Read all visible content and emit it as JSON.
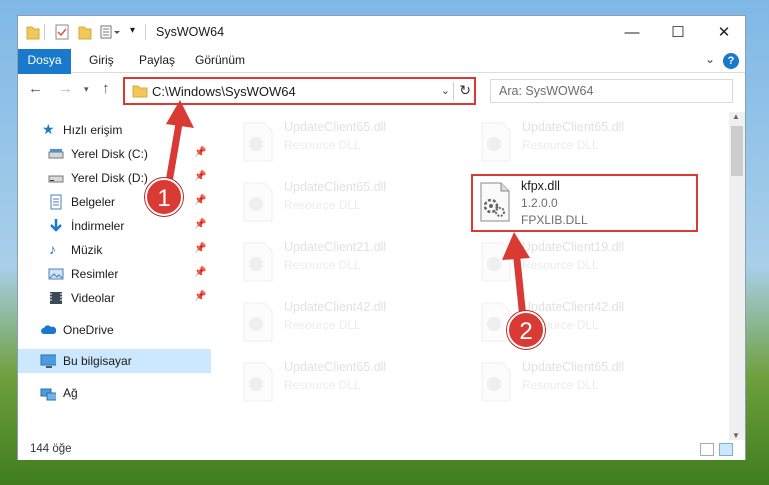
{
  "window": {
    "title": "SysWOW64",
    "controls": {
      "minimize": "—",
      "maximize": "☐",
      "close": "✕"
    }
  },
  "ribbon": {
    "tabs": [
      "Dosya",
      "Giriş",
      "Paylaş",
      "Görünüm"
    ]
  },
  "navigation": {
    "address": "C:\\Windows\\SysWOW64",
    "search_placeholder": "Ara: SysWOW64"
  },
  "sidebar": {
    "items": [
      {
        "label": "Hızlı erişim",
        "icon": "star-icon"
      },
      {
        "label": "Yerel Disk (C:)",
        "icon": "drive-icon",
        "pinned": true
      },
      {
        "label": "Yerel Disk (D:)",
        "icon": "drive-icon",
        "pinned": true
      },
      {
        "label": "Belgeler",
        "icon": "documents-icon",
        "pinned": true
      },
      {
        "label": "İndirmeler",
        "icon": "download-icon",
        "pinned": true
      },
      {
        "label": "Müzik",
        "icon": "music-icon",
        "pinned": true
      },
      {
        "label": "Resimler",
        "icon": "pictures-icon",
        "pinned": true
      },
      {
        "label": "Videolar",
        "icon": "videos-icon",
        "pinned": true
      },
      {
        "label": "OneDrive",
        "icon": "cloud-icon"
      },
      {
        "label": "Bu bilgisayar",
        "icon": "computer-icon",
        "selected": true
      },
      {
        "label": "Ağ",
        "icon": "network-icon"
      }
    ]
  },
  "files": [
    {
      "name": "UpdateClient65.dll",
      "type": "Resource DLL"
    },
    {
      "name": "UpdateClient65.dll",
      "type": "Resource DLL"
    },
    {
      "name": "UpdateClient65.dll",
      "type": "Resource DLL"
    },
    {
      "name": "kfpx.dll",
      "version": "1.2.0.0",
      "description": "FPXLIB.DLL"
    },
    {
      "name": "UpdateClient21.dll",
      "type": "Resource DLL"
    },
    {
      "name": "UpdateClient19.dll",
      "type": "Resource DLL"
    },
    {
      "name": "UpdateClient42.dll",
      "type": "Resource DLL"
    },
    {
      "name": "UpdateClient42.dll",
      "type": "Resource DLL"
    },
    {
      "name": "UpdateClient65.dll",
      "type": "Resource DLL"
    },
    {
      "name": "UpdateClient65.dll",
      "type": "Resource DLL"
    }
  ],
  "status": {
    "item_count": "144 öğe"
  },
  "annotations": {
    "step1": "1",
    "step2": "2",
    "color": "#d93a33"
  }
}
